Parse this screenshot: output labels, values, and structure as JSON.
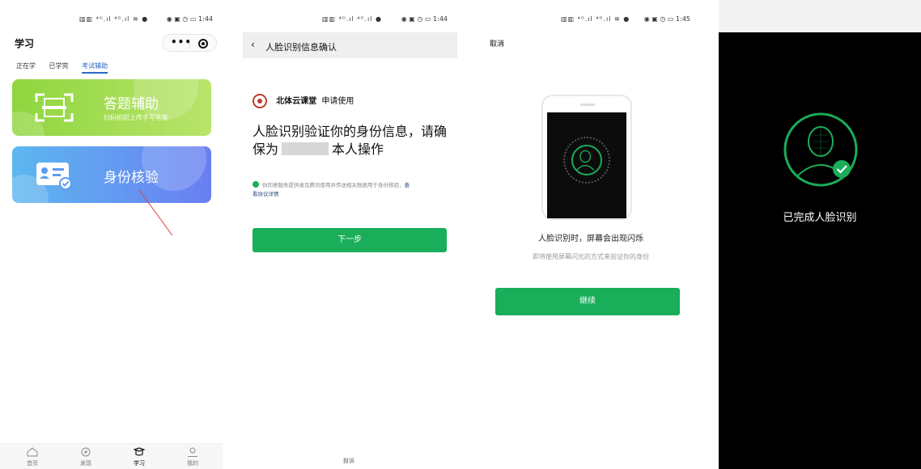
{
  "colors": {
    "green": "#1aad5a",
    "blue_tab": "#2a6ac7",
    "arrow": "#e04040"
  },
  "screen1": {
    "status": {
      "signal": "▥▥ ⁴ᴳ.ıl ⁴ᴳ.ıl ≋ ●",
      "right": "◉ ▣ ◷ ▭ 1:44"
    },
    "title": "学习",
    "capsule": {
      "more": "•••"
    },
    "tabs": [
      {
        "label": "正在学"
      },
      {
        "label": "已学完"
      },
      {
        "label": "考试辅助"
      }
    ],
    "cards": [
      {
        "title": "答题辅助",
        "subtitle": "扫码拍照上传手写答案",
        "icon": "scan-icon"
      },
      {
        "title": "身份核验",
        "icon": "id-card-icon"
      }
    ],
    "tabbar": [
      {
        "label": "首页",
        "icon": "home-icon"
      },
      {
        "label": "发现",
        "icon": "compass-icon"
      },
      {
        "label": "学习",
        "icon": "graduation-cap-icon"
      },
      {
        "label": "我的",
        "icon": "user-icon"
      }
    ]
  },
  "screen2": {
    "status": {
      "signal": "▥▥ ⁴ᴳ.ıl ⁴ᴳ.ıl ●",
      "right": "◉ ▣ ◷ ▭ 1:44"
    },
    "nav_title": "人脸识别信息确认",
    "app_name": "北体云课堂",
    "app_suffix": "申请使用",
    "verify_line1": "人脸识别验证你的身份信息，请确",
    "verify_pre": "保为",
    "verify_post": "本人操作",
    "agree_text": "你同意服务提供者及腾讯使用并传送相关数据用于身份核验，",
    "agree_link1": "查",
    "agree_link2": "看协议详情",
    "next_button": "下一步",
    "complain": "投诉"
  },
  "screen3": {
    "status": {
      "signal": "▥▥ ⁴ᴳ.ıl ⁴ᴳ.ıl ≋ ●",
      "right": "◉ ▣ ◷ ▭ 1:45"
    },
    "cancel": "取消",
    "hint_main": "人脸识别时，屏幕会出现闪烁",
    "hint_sub": "即将使用屏幕闪光的方式来验证你的身份",
    "continue_button": "继续"
  },
  "screen4": {
    "done_text": "已完成人脸识别"
  }
}
